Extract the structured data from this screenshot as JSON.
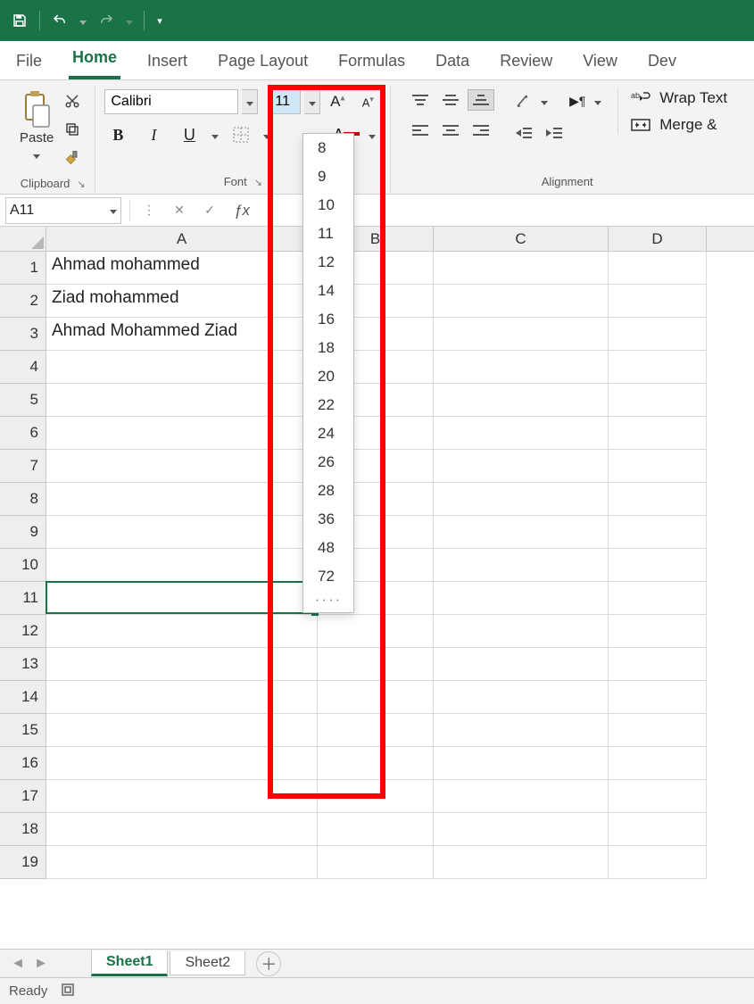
{
  "titlebar": {
    "save_icon": "save-icon",
    "undo_icon": "undo-icon",
    "redo_icon": "redo-icon"
  },
  "tabs": [
    "File",
    "Home",
    "Insert",
    "Page Layout",
    "Formulas",
    "Data",
    "Review",
    "View",
    "Dev"
  ],
  "active_tab": "Home",
  "ribbon": {
    "clipboard": {
      "label": "Clipboard",
      "paste": "Paste"
    },
    "font": {
      "label": "Font",
      "name": "Calibri",
      "size": "11",
      "sizes": [
        "8",
        "9",
        "10",
        "11",
        "12",
        "14",
        "16",
        "18",
        "20",
        "22",
        "24",
        "26",
        "28",
        "36",
        "48",
        "72"
      ]
    },
    "alignment": {
      "label": "Alignment",
      "wrap": "Wrap Text",
      "merge": "Merge &"
    }
  },
  "namebox": "A11",
  "columns": [
    "A",
    "B",
    "C",
    "D"
  ],
  "rows_visible": 19,
  "selected_cell": {
    "row": 11,
    "col": "A"
  },
  "cells": {
    "A1": "Ahmad mohammed",
    "A2": "Ziad mohammed",
    "A3": "Ahmad Mohammed Ziad"
  },
  "sheets": {
    "items": [
      "Sheet1",
      "Sheet2"
    ],
    "active": "Sheet1"
  },
  "status": {
    "ready": "Ready"
  }
}
